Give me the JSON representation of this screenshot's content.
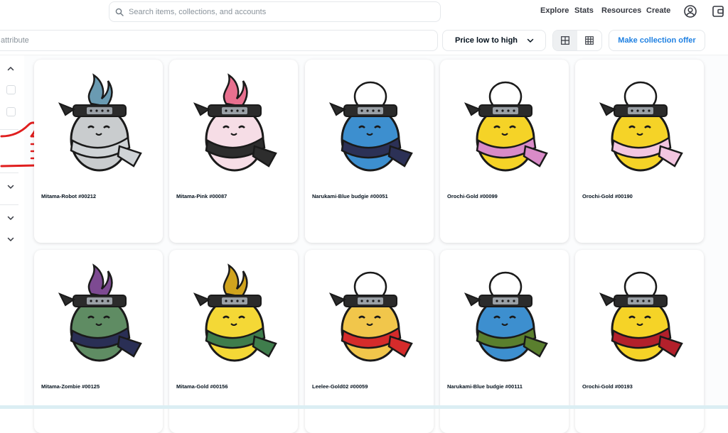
{
  "search": {
    "placeholder": "Search items, collections, and accounts"
  },
  "nav": {
    "explore": "Explore",
    "stats": "Stats",
    "resources": "Resources",
    "create": "Create"
  },
  "icons": {
    "search": "search-icon",
    "profile": "profile-icon",
    "wallet": "wallet-icon",
    "chevron": "chevron-down-icon",
    "grid_large": "grid-large-icon",
    "grid_small": "grid-small-icon",
    "hand": "pointing-hand-annotation-icon"
  },
  "filters": {
    "attribute_placeholder": "attribute",
    "sort_label": "Price low to high",
    "offer_label": "Make collection offer"
  },
  "colors": {
    "accent": "#2081e2",
    "annotation": "#e01e1e"
  },
  "items": [
    {
      "name": "Mitama-Robot #00212",
      "flame": "#6a9bb2",
      "body": "#c9ccce",
      "scarf": "#cfd3d6"
    },
    {
      "name": "Mitama-Pink #00087",
      "flame": "#e8708f",
      "body": "#f6dde6",
      "scarf": "#2d2d2d"
    },
    {
      "name": "Narukami-Blue budgie #00051",
      "flame": "",
      "body": "#3d8fcf",
      "scarf": "#2c3156"
    },
    {
      "name": "Orochi-Gold #00099",
      "flame": "",
      "body": "#f5d327",
      "scarf": "#d98bc8"
    },
    {
      "name": "Orochi-Gold #00190",
      "flame": "",
      "body": "#f5d327",
      "scarf": "#f3c6e0"
    },
    {
      "name": "Mitama-Zombie #00125",
      "flame": "#7d4a92",
      "body": "#5f8c63",
      "scarf": "#2a2f55"
    },
    {
      "name": "Mitama-Gold #00156",
      "flame": "#d0a31e",
      "body": "#f4d836",
      "scarf": "#3f7d4c"
    },
    {
      "name": "Leelee-Gold02 #00059",
      "flame": "",
      "body": "#f1c64b",
      "scarf": "#d52b2b"
    },
    {
      "name": "Narukami-Blue budgie #00111",
      "flame": "",
      "body": "#3d8fcf",
      "scarf": "#5a7f2e"
    },
    {
      "name": "Orochi-Gold #00193",
      "flame": "",
      "body": "#f5d327",
      "scarf": "#b3202b"
    }
  ]
}
